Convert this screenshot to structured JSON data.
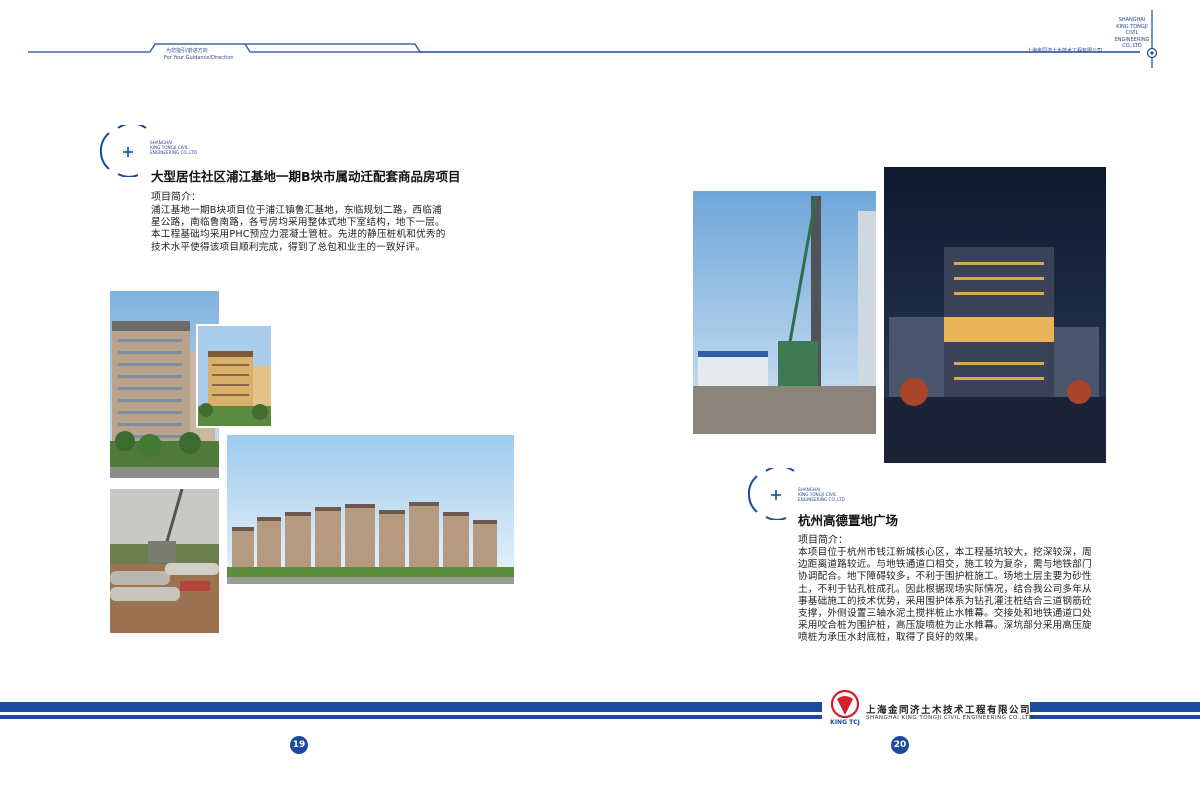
{
  "header": {
    "guidance_cn": "为您指引/前进方向",
    "guidance_en": "For Your Guidance/Direction",
    "company_cn": "上海金同济土木技术工程有限公司",
    "corner_en": [
      "SHANGHAI",
      "KING TONGJI",
      "CIVIL",
      "ENGINEERING",
      "CO.,LTD"
    ]
  },
  "section_logo_en": [
    "SHANGHAI",
    "KING TONGJI CIVIL",
    "ENGINEERING CO.,LTD"
  ],
  "project1": {
    "title": "大型居住社区浦江基地一期B块市属动迁配套商品房项目",
    "label": "项目简介：",
    "lines": [
      "浦江基地一期B块项目位于浦江镇鲁汇基地，东临规划二路，西临浦",
      "星公路，南临鲁南路，各号房均采用整体式地下室结构，地下一层。",
      "本工程基础均采用PHC预应力混凝土管桩。先进的静压桩机和优秀的",
      "技术水平使得该项目顺利完成，得到了总包和业主的一致好评。"
    ]
  },
  "project2": {
    "title": "杭州高德置地广场",
    "label": "项目简介：",
    "lines": [
      "本项目位于杭州市钱江新城核心区，本工程基坑较大，挖深较深，周",
      "边距离道路较近。与地铁通道口相交，施工较为复杂，需与地铁部门",
      "协调配合。地下障碍较多，不利于围护桩施工。场地土层主要为砂性",
      "土，不利于钻孔桩成孔。因此根据现场实际情况，结合我公司多年从",
      "事基础施工的技术优势，采用围护体系为钻孔灌注桩结合三道钢筋砼",
      "支撑，外侧设置三轴水泥土搅拌桩止水帷幕。交接处和地铁通道口处",
      "采用咬合桩为围护桩，高压旋喷桩为止水帷幕。深坑部分采用高压旋",
      "喷桩为承压水封底桩，取得了良好的效果。"
    ]
  },
  "footer": {
    "company_cn": "上海金同济土木技术工程有限公司",
    "company_en": "SHANGHAI KING TONGJI CIVIL ENGINEERING CO.,LTD",
    "logo_text": "KING TCJ",
    "page_left": "19",
    "page_right": "20"
  },
  "colors": {
    "brand_blue": "#1b4a9c",
    "logo_red": "#d2202a"
  }
}
